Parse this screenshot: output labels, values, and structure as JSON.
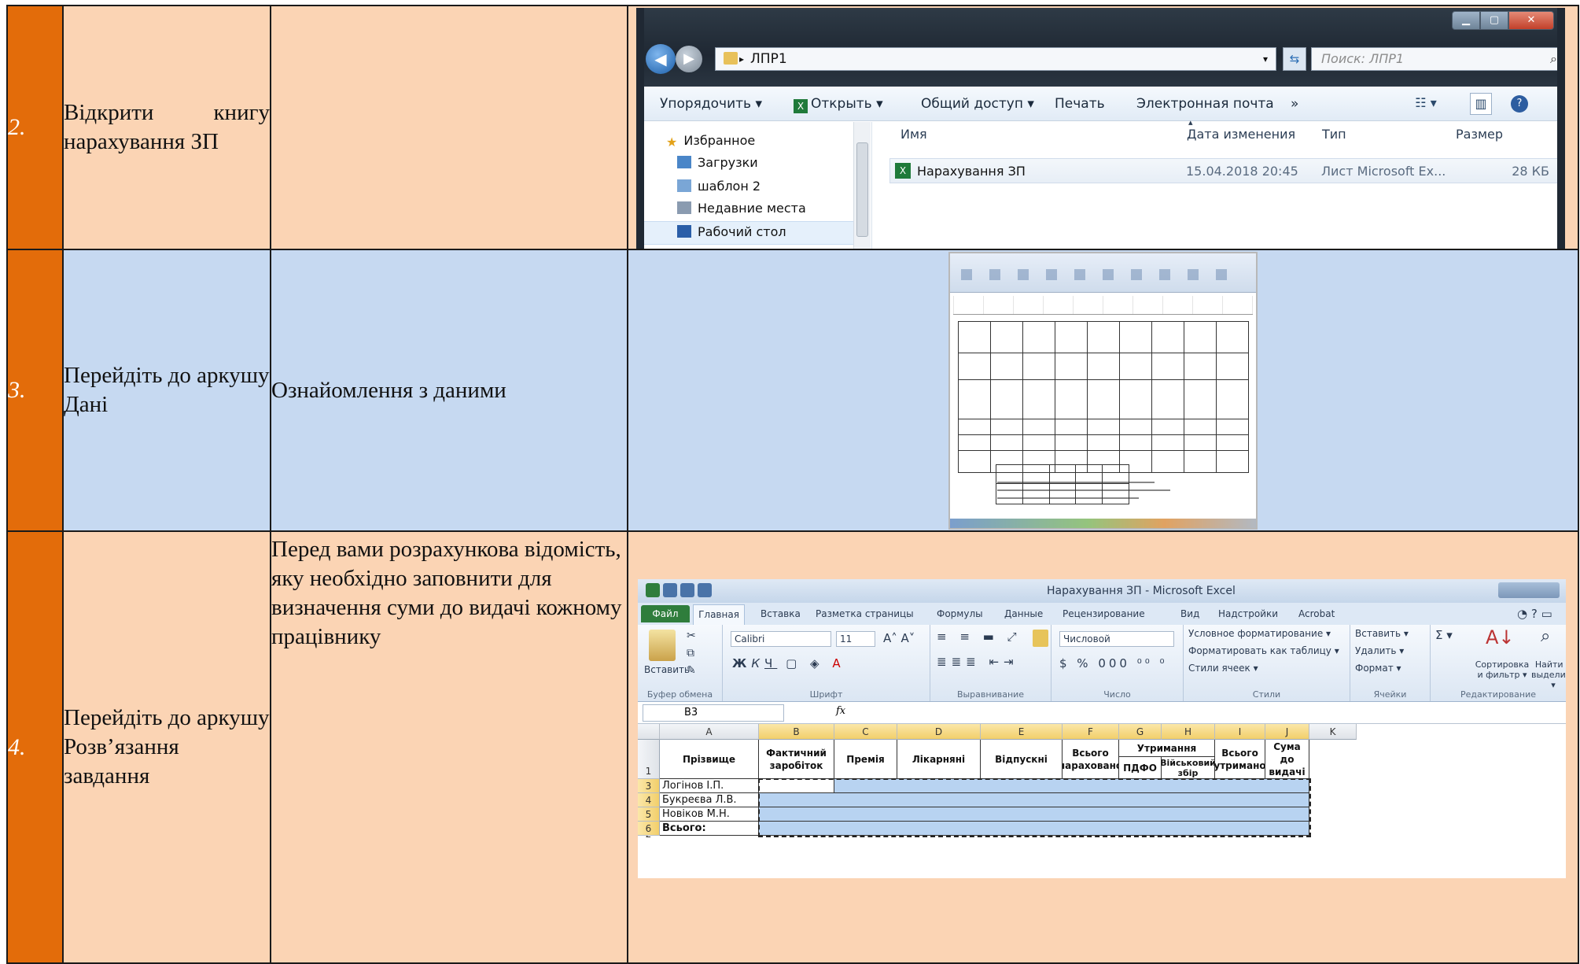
{
  "rows": [
    {
      "num": "2.",
      "task": "Відкрити книгу нарахування ЗП",
      "desc": ""
    },
    {
      "num": "3.",
      "task": "Перейдіть до аркушу Дані",
      "desc": "Ознайомлення з даними"
    },
    {
      "num": "4.",
      "task": "Перейдіть до аркушу Розв’язання завдання",
      "desc": "Перед вами розрахункова відомість, яку необхідно заповнити для визначення суми до видачі кожному працівнику"
    }
  ],
  "explorer": {
    "path": "ЛПР1",
    "search_placeholder": "Поиск: ЛПР1",
    "toolbar": [
      "Упорядочить ▾",
      "Открыть ▾",
      "Общий доступ ▾",
      "Печать",
      "Электронная почта",
      "»"
    ],
    "nav": [
      "Избранное",
      "Загрузки",
      "шаблон 2",
      "Недавние места",
      "Рабочий стол"
    ],
    "columns": [
      "Имя",
      "Дата изменения",
      "Тип",
      "Размер"
    ],
    "file": {
      "name": "Нарахування ЗП",
      "date": "15.04.2018 20:45",
      "type": "Лист Microsoft Ex...",
      "size": "28 КБ"
    }
  },
  "excel": {
    "title": "Нарахування ЗП - Microsoft Excel",
    "tabs": [
      "Файл",
      "Главная",
      "Вставка",
      "Разметка страницы",
      "Формулы",
      "Данные",
      "Рецензирование",
      "Вид",
      "Надстройки",
      "Acrobat"
    ],
    "font_name": "Calibri",
    "font_size": "11",
    "number_format": "Числовой",
    "group_labels": [
      "Буфер обмена",
      "Шрифт",
      "Выравнивание",
      "Число",
      "Стили",
      "Ячейки",
      "Редактирование"
    ],
    "ribbon_labels": {
      "paste": "Вставить",
      "cond_format": "Условное форматирование ▾",
      "format_table": "Форматировать как таблицу ▾",
      "cell_styles": "Стили ячеек ▾",
      "insert": "Вставить ▾",
      "delete": "Удалить ▾",
      "format": "Формат ▾",
      "sort": "Сортировка и фильтр ▾",
      "find": "Найти и выделить ▾"
    },
    "name_box": "B3",
    "col_letters": [
      "A",
      "B",
      "C",
      "D",
      "E",
      "F",
      "G",
      "H",
      "I",
      "J",
      "K"
    ],
    "headers": {
      "surname": "Прізвище",
      "actual": "Фактичний заробіток",
      "bonus": "Премія",
      "sick": "Лікарняні",
      "vacation": "Відпускні",
      "total_accrued": "Всього нараховано",
      "deductions": "Утримання",
      "pdfo": "ПДФО",
      "military": "Військовий збір",
      "total_deducted": "Всього утримано",
      "to_pay": "Сума до видачі"
    },
    "names": [
      "Логінов І.П.",
      "Букреєва Л.В.",
      "Новіков М.Н.",
      "Всього:"
    ]
  }
}
